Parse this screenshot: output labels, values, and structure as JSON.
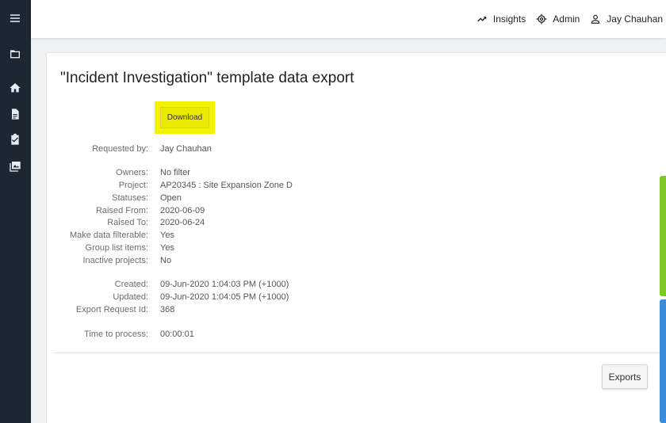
{
  "sidebar": {
    "icons": [
      "menu-icon",
      "folder-icon",
      "home-icon",
      "document-icon",
      "clipboard-check-icon",
      "photo-library-icon"
    ]
  },
  "topnav": {
    "insights": "Insights",
    "admin": "Admin",
    "user": "Jay Chauhan"
  },
  "page": {
    "title": "\"Incident Investigation\" template data export",
    "download_label": "Download",
    "exports_label": "Exports"
  },
  "details": {
    "requested_by": {
      "label": "Requested by:",
      "value": "Jay Chauhan"
    },
    "owners": {
      "label": "Owners:",
      "value": "No filter"
    },
    "project": {
      "label": "Project:",
      "value": "AP20345 : Site Expansion Zone D"
    },
    "statuses": {
      "label": "Statuses:",
      "value": "Open"
    },
    "raised_from": {
      "label": "Raised From:",
      "value": "2020-06-09"
    },
    "raised_to": {
      "label": "Raised To:",
      "value": "2020-06-24"
    },
    "make_filterable": {
      "label": "Make data filterable:",
      "value": "Yes"
    },
    "group_list": {
      "label": "Group list items:",
      "value": "Yes"
    },
    "inactive_projects": {
      "label": "Inactive projects:",
      "value": "No"
    },
    "created": {
      "label": "Created:",
      "value": "09-Jun-2020 1:04:03 PM (+1000)"
    },
    "updated": {
      "label": "Updated:",
      "value": "09-Jun-2020 1:04:05 PM (+1000)"
    },
    "export_id": {
      "label": "Export Request Id:",
      "value": "368"
    },
    "time_to_process": {
      "label": "Time to process:",
      "value": "00:00:01"
    }
  },
  "colors": {
    "sidebar": "#1c2733",
    "highlight": "#f3f100",
    "tab_green": "#7dc729",
    "tab_blue": "#3b8ddb"
  }
}
